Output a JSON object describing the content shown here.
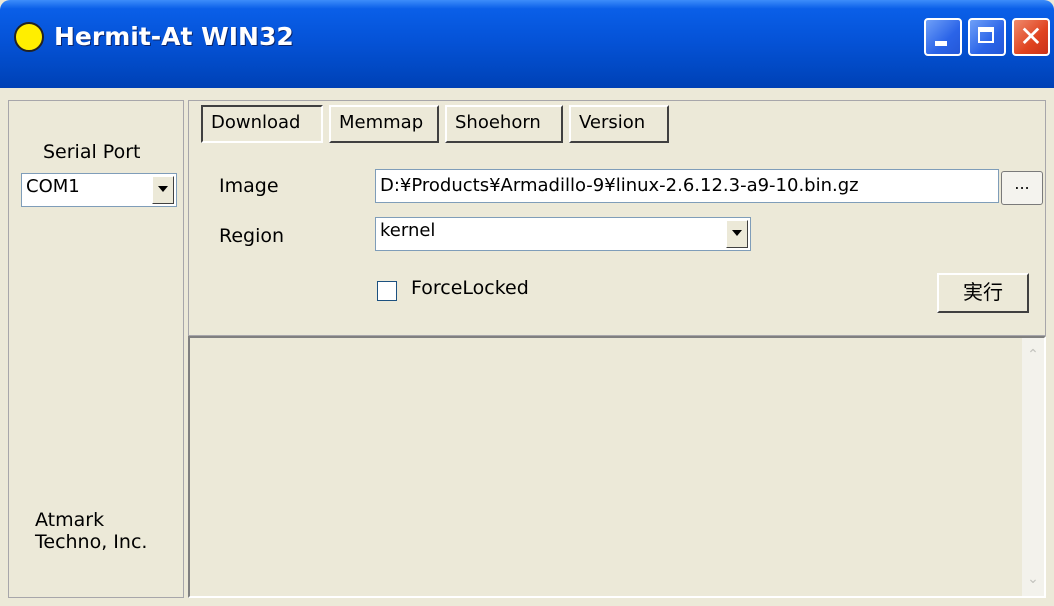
{
  "window": {
    "title": "Hermit-At WIN32",
    "close_glyph": "✕",
    "colors": {
      "titlebar": "#0553d8",
      "face": "#ece9d8",
      "dot": "#ffee00"
    }
  },
  "left": {
    "serial_label": "Serial Port",
    "serial_value": "COM1",
    "company_line1": "Atmark",
    "company_line2": "Techno, Inc."
  },
  "tabs": [
    {
      "label": "Download",
      "active": true
    },
    {
      "label": "Memmap",
      "active": false
    },
    {
      "label": "Shoehorn",
      "active": false
    },
    {
      "label": "Version",
      "active": false
    }
  ],
  "download": {
    "image_label": "Image",
    "image_value": "D:¥Products¥Armadillo-9¥linux-2.6.12.3-a9-10.bin.gz",
    "browse_label": "...",
    "region_label": "Region",
    "region_value": "kernel",
    "force_label": "ForceLocked",
    "force_checked": false,
    "run_label": "実行"
  },
  "scroll_glyphs": {
    "up": "⌃",
    "down": "⌄"
  }
}
